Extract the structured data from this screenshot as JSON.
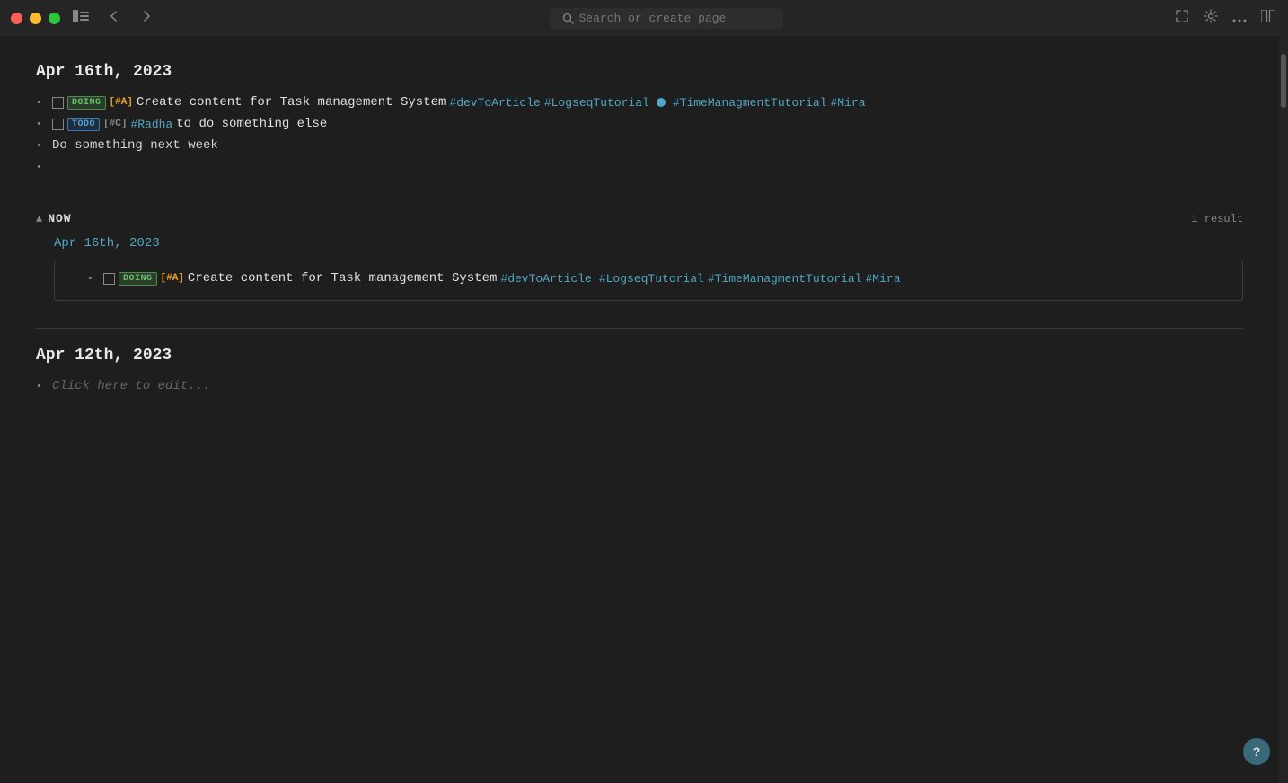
{
  "titlebar": {
    "search_placeholder": "Search or create page",
    "nav_back": "‹",
    "nav_forward": "›"
  },
  "icons": {
    "sidebar_toggle": "sidebar-icon",
    "back": "back-icon",
    "forward": "forward-icon",
    "search": "search-icon",
    "fullscreen": "fullscreen-icon",
    "settings": "settings-icon",
    "more": "more-icon",
    "split": "split-icon",
    "help": "?"
  },
  "journal": {
    "date1": "Apr 16th, 2023",
    "date2": "Apr 12th, 2023"
  },
  "entries": {
    "entry1": {
      "badge": "DOING",
      "priority": "[#A]",
      "task": "Create content for Task management System",
      "tags": [
        "#devToArticle",
        "#LogseqTutorial",
        "#TimeManagmentTutorial",
        "#Mira"
      ]
    },
    "entry2": {
      "badge": "TODO",
      "priority": "[#C]",
      "tag_person": "#Radha",
      "task": "to do something else"
    },
    "entry3": {
      "text": "Do something next week"
    }
  },
  "now_section": {
    "label": "NOW",
    "result_count": "1 result",
    "date": "Apr 16th, 2023",
    "entry": {
      "badge": "DOING",
      "priority": "[#A]",
      "task": "Create content for Task management System",
      "tags": [
        "#devToArticle",
        "#LogseqTutorial",
        "#TimeManagmentTutorial",
        "#Mira"
      ]
    }
  },
  "apr12": {
    "click_edit": "Click here to edit..."
  }
}
